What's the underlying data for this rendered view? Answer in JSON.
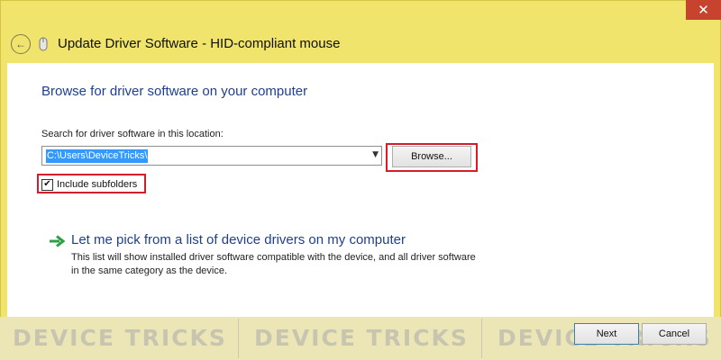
{
  "window": {
    "title": "Update Driver Software - HID-compliant mouse",
    "close_glyph": "✕",
    "back_glyph": "←"
  },
  "content": {
    "heading": "Browse for driver software on your computer",
    "search_label": "Search for driver software in this location:",
    "path_value": "C:\\Users\\DeviceTricks\\",
    "combo_arrow": "▼",
    "browse_label": "Browse...",
    "include_subfolders": {
      "label": "Include subfolders",
      "checked": true,
      "check_glyph": "✔"
    },
    "pick": {
      "link": "Let me pick from a list of device drivers on my computer",
      "description": "This list will show installed driver software compatible with the device, and all driver software in the same category as the device."
    }
  },
  "footer": {
    "next_label": "Next",
    "cancel_label": "Cancel"
  },
  "watermark": {
    "text": "DEVICE TRICKS"
  },
  "colors": {
    "frame": "#f0e46c",
    "heading": "#1e3f8f",
    "highlight": "#d21d2a",
    "close": "#c7432e",
    "arrow": "#2ea043",
    "selection": "#3399ff"
  },
  "icons": {
    "back": "back-arrow-icon",
    "device": "mouse-icon",
    "pick": "green-arrow-icon",
    "close": "close-icon",
    "dropdown": "chevron-down-icon",
    "check": "checkmark-icon"
  }
}
